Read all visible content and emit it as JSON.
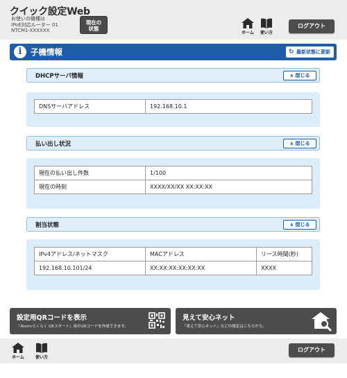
{
  "header": {
    "app_title": "クイック設定Web",
    "device_line1": "お使いの機種は",
    "device_line2": "IPoE対応ルーター 01",
    "device_line3": "NTCM1-XXXXXX",
    "status_line1": "現在の",
    "status_line2": "状態",
    "home_label": "ホーム",
    "help_label": "使い方",
    "logout_label": "ログアウト"
  },
  "titlebar": {
    "icon": "info-icon",
    "title": "子機情報",
    "refresh_label": "最新状態に更新"
  },
  "sections": {
    "dhcp": {
      "title": "DHCPサーバ情報",
      "close_label": "閉じる",
      "rows": [
        {
          "label": "DNSサーバアドレス",
          "value": "192.168.10.1"
        }
      ]
    },
    "lease": {
      "title": "払い出し状況",
      "close_label": "閉じる",
      "rows": [
        {
          "label": "現在の払い出し件数",
          "value": "1/100"
        },
        {
          "label": "現在の時刻",
          "value": "XXXX/XX/XX XX:XX:XX"
        }
      ]
    },
    "assign": {
      "title": "割当状態",
      "close_label": "閉じる",
      "headers": [
        "IPv4アドレス/ネットマスク",
        "MACアドレス",
        "リース時間(秒)"
      ],
      "rows": [
        [
          "192.168.10.101/24",
          "XX:XX:XX:XX:XX:XX",
          "XXXX"
        ]
      ]
    }
  },
  "banners": {
    "qr": {
      "title": "設定用QRコードを表示",
      "subtitle": "「Atermらくらく QRスタート」用のQRコードを作成できます。",
      "icon": "qr-code-icon"
    },
    "safe": {
      "title": "見えて安心ネット",
      "subtitle": "「見えて安心ネット」などの設定はこちらから。",
      "icon": "home-search-icon"
    }
  },
  "footer": {
    "home_label": "ホーム",
    "help_label": "使い方",
    "logout_label": "ログアウト"
  },
  "colors": {
    "primary": "#1e5ea8",
    "section_bg": "#dcedfa",
    "section_border": "#8fbde6",
    "dark_button": "#4c4c4c"
  }
}
